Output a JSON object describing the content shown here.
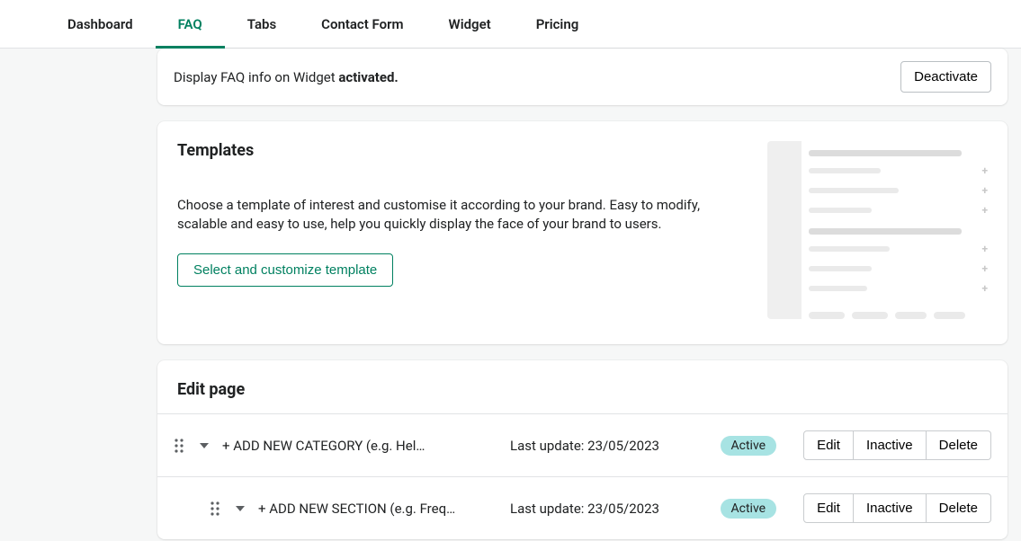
{
  "nav": {
    "tabs": [
      {
        "label": "Dashboard",
        "active": false
      },
      {
        "label": "FAQ",
        "active": true
      },
      {
        "label": "Tabs",
        "active": false
      },
      {
        "label": "Contact Form",
        "active": false
      },
      {
        "label": "Widget",
        "active": false
      },
      {
        "label": "Pricing",
        "active": false
      }
    ]
  },
  "activation": {
    "prefix": "Display FAQ info on Widget ",
    "state": "activated.",
    "deactivate_label": "Deactivate"
  },
  "templates": {
    "heading": "Templates",
    "description": "Choose a template of interest and customise it according to your brand. Easy to modify, scalable and easy to use, help you quickly display the face of your brand to users.",
    "select_button": "Select and customize template"
  },
  "editpage": {
    "heading": "Edit page",
    "rows": [
      {
        "title": "+ ADD NEW CATEGORY (e.g. Hel…",
        "last_update": "Last update: 23/05/2023",
        "status": "Active",
        "actions": {
          "edit": "Edit",
          "inactive": "Inactive",
          "delete": "Delete"
        },
        "indent": 0
      },
      {
        "title": "+ ADD NEW SECTION (e.g. Freq…",
        "last_update": "Last update: 23/05/2023",
        "status": "Active",
        "actions": {
          "edit": "Edit",
          "inactive": "Inactive",
          "delete": "Delete"
        },
        "indent": 1
      }
    ]
  }
}
